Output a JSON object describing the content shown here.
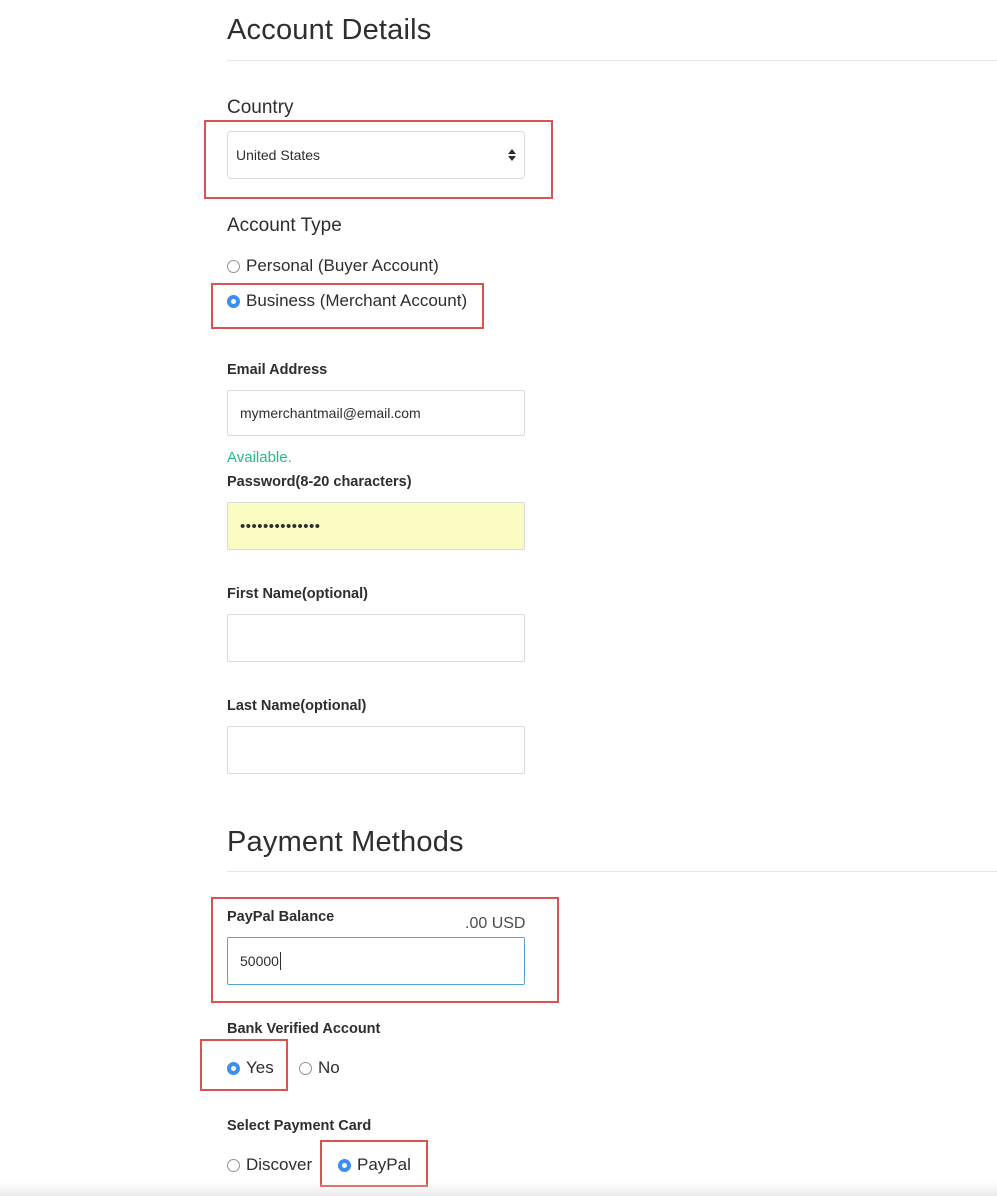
{
  "account": {
    "title": "Account Details",
    "country_label": "Country",
    "country_value": "United States",
    "account_type_label": "Account Type",
    "account_types": [
      {
        "label": "Personal (Buyer Account)",
        "checked": false
      },
      {
        "label": "Business (Merchant Account)",
        "checked": true
      }
    ],
    "email_label": "Email Address",
    "email_value": "mymerchantmail@email.com",
    "email_status": "Available.",
    "password_label": "Password(8-20 characters)",
    "password_value": "••••••••••••••",
    "first_name_label": "First Name(optional)",
    "first_name_value": "",
    "last_name_label": "Last Name(optional)",
    "last_name_value": ""
  },
  "payment": {
    "title": "Payment Methods",
    "balance_label": "PayPal Balance",
    "balance_suffix": ".00 USD",
    "balance_value": "50000",
    "bank_label": "Bank Verified Account",
    "bank_options": [
      {
        "label": "Yes",
        "checked": true
      },
      {
        "label": "No",
        "checked": false
      }
    ],
    "card_label": "Select Payment Card",
    "card_options": [
      {
        "label": "Discover",
        "checked": false
      },
      {
        "label": "PayPal",
        "checked": true
      }
    ]
  },
  "colors": {
    "highlight": "#d9534f",
    "radio_checked": "#3b8ff0",
    "available_text": "#1fbd8d",
    "password_bg": "#fafcc1"
  },
  "icons": {
    "select_arrows": "select-arrows-icon"
  }
}
